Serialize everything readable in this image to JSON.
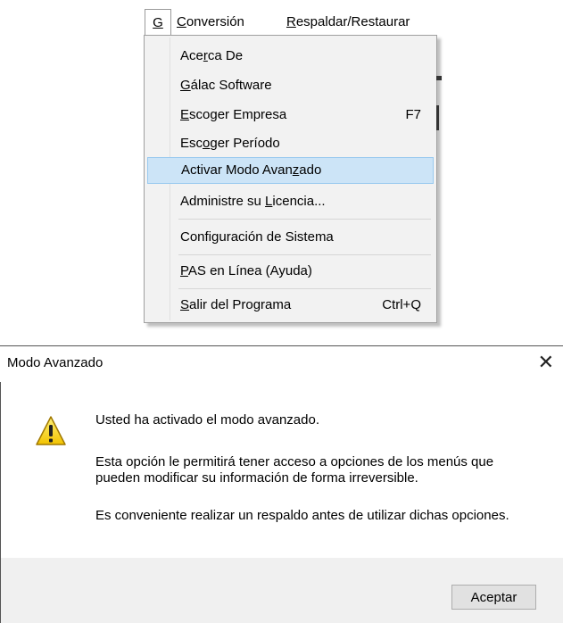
{
  "menubar": {
    "items": [
      {
        "label": "G",
        "mnemonic": "G"
      },
      {
        "label": "Conversión"
      },
      {
        "label": "Respaldar/Restaurar"
      }
    ]
  },
  "dropdown": {
    "items": [
      {
        "pre": "Ace",
        "mn": "r",
        "post": "ca De",
        "shortcut": ""
      },
      {
        "pre": "",
        "mn": "G",
        "post": "álac Software",
        "shortcut": ""
      },
      {
        "pre": "",
        "mn": "E",
        "post": "scoger Empresa",
        "shortcut": "F7"
      },
      {
        "pre": "Esc",
        "mn": "o",
        "post": "ger Período",
        "shortcut": ""
      },
      {
        "pre": "Activar Modo Avan",
        "mn": "z",
        "post": "ado",
        "shortcut": "",
        "highlighted": true
      },
      {
        "pre": "Administre su ",
        "mn": "L",
        "post": "icencia...",
        "shortcut": ""
      },
      {
        "pre": "Confi",
        "mn": "g",
        "post": "uración de Sistema",
        "shortcut": ""
      },
      {
        "pre": "",
        "mn": "P",
        "post": "AS en Línea (Ayuda)",
        "shortcut": ""
      },
      {
        "pre": "",
        "mn": "S",
        "post": "alir del Programa",
        "shortcut": "Ctrl+Q"
      }
    ],
    "highlight_color": "#cce4f7"
  },
  "dialog": {
    "title": "Modo Avanzado",
    "close_glyph": "✕",
    "icon": "warning-icon",
    "message_1": "Usted ha activado el modo avanzado.",
    "message_2": "Esta opción le permitirá tener acceso a opciones de los menús que pueden modificar su información de forma irreversible.",
    "message_3": "Es conveniente realizar un respaldo antes de utilizar dichas opciones.",
    "ok_label": "Aceptar"
  }
}
